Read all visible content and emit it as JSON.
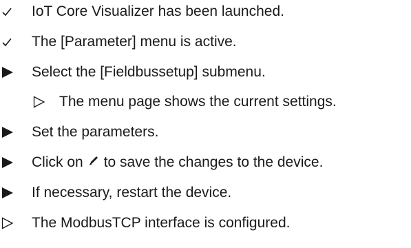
{
  "steps": [
    {
      "type": "precondition",
      "marker_icon": "checkmark-icon",
      "text": "IoT Core Visualizer has been launched."
    },
    {
      "type": "precondition",
      "marker_icon": "checkmark-icon",
      "text": "The [Parameter] menu is active."
    },
    {
      "type": "action",
      "marker_icon": "filled-triangle-icon",
      "text": "Select the [Fieldbussetup] submenu."
    },
    {
      "type": "intermediate-result",
      "marker_icon": "outline-triangle-icon",
      "text": "The menu page shows the current settings."
    },
    {
      "type": "action",
      "marker_icon": "filled-triangle-icon",
      "text": "Set the parameters."
    },
    {
      "type": "action",
      "marker_icon": "filled-triangle-icon",
      "text_before": "Click on",
      "inline_icon": "pencil-icon",
      "text_after": "to save the changes to the device."
    },
    {
      "type": "action",
      "marker_icon": "filled-triangle-icon",
      "text": "If necessary, restart the device."
    },
    {
      "type": "result",
      "marker_icon": "outline-triangle-icon",
      "text": "The ModbusTCP interface is configured."
    }
  ],
  "colors": {
    "text": "#1a1a1a",
    "background": "#ffffff"
  }
}
